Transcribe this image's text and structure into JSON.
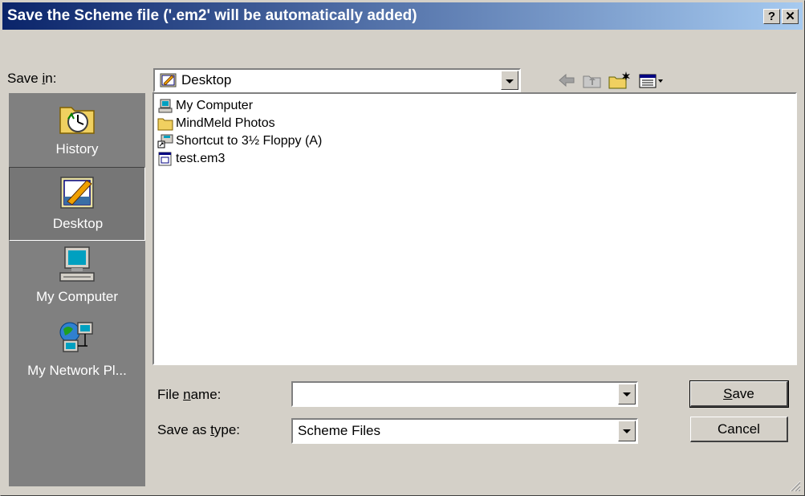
{
  "window": {
    "title": "Save the Scheme file ('.em2' will be automatically added)",
    "help_label": "?",
    "close_label": "✕"
  },
  "save_in": {
    "label_pre": "Save ",
    "label_key": "i",
    "label_post": "n:",
    "value": "Desktop"
  },
  "toolbar": {
    "icons": [
      "back-arrow-icon",
      "up-folder-icon",
      "new-folder-icon",
      "view-menu-icon"
    ]
  },
  "places": [
    {
      "label": "History",
      "icon": "history-icon"
    },
    {
      "label": "Desktop",
      "icon": "desktop-icon",
      "selected": true
    },
    {
      "label": "My Computer",
      "icon": "my-computer-icon"
    },
    {
      "label": "My Network Pl...",
      "icon": "network-places-icon"
    }
  ],
  "files": [
    {
      "name": "My Computer",
      "icon": "my-computer-icon"
    },
    {
      "name": "MindMeld Photos",
      "icon": "folder-icon"
    },
    {
      "name": "Shortcut to 3½ Floppy (A)",
      "icon": "floppy-shortcut-icon"
    },
    {
      "name": "test.em3",
      "icon": "file-icon"
    }
  ],
  "file_name": {
    "label_pre": "File ",
    "label_key": "n",
    "label_post": "ame:",
    "value": ""
  },
  "save_as_type": {
    "label_pre": "Save as ",
    "label_key": "t",
    "label_post": "ype:",
    "value": "Scheme Files"
  },
  "buttons": {
    "save_key": "S",
    "save_rest": "ave",
    "cancel": "Cancel"
  },
  "colors": {
    "title_start": "#0a246a",
    "title_end": "#a6caf0",
    "face": "#d4d0c8",
    "places_bg": "#808080"
  }
}
